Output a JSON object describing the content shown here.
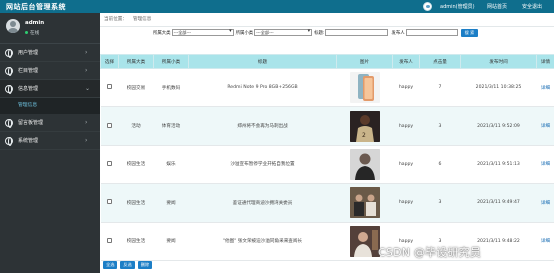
{
  "header": {
    "title": "网站后台管理系统",
    "user_label": "admin(管理员)",
    "home_link": "网站首页",
    "logout_link": "安全退出"
  },
  "sidebar": {
    "profile_name": "admin",
    "profile_status": "在线",
    "items": [
      {
        "label": "用户管理"
      },
      {
        "label": "栏目管理"
      },
      {
        "label": "信息管理"
      },
      {
        "label": "留言板管理"
      },
      {
        "label": "系统管理"
      }
    ],
    "subitem": "管理信息"
  },
  "breadcrumb": {
    "prefix": "当前位置：",
    "current": "管理信息"
  },
  "search": {
    "category_label": "所属大类",
    "category_value": "---全部---",
    "subcategory_label": "所属小类",
    "subcategory_value": "---全部---",
    "title_label": "标题:",
    "title_value": "",
    "author_label": "发布人",
    "author_value": "",
    "search_button": "搜 索"
  },
  "table": {
    "headers": [
      "选择",
      "所属大类",
      "所属小类",
      "标题",
      "图片",
      "发布人",
      "点击量",
      "发布时间",
      "详情"
    ],
    "rows": [
      {
        "category": "校园交易",
        "subcategory": "手机数码",
        "title": "Redmi Note 9 Pro 8GB+256GB",
        "author": "happy",
        "clicks": "7",
        "time": "2021/3/11 10:38:25",
        "detail": "详细"
      },
      {
        "category": "活动",
        "subcategory": "体育活动",
        "title": "郑州将不会再为马刺出战",
        "author": "happy",
        "clicks": "3",
        "time": "2021/3/11 9:52:09",
        "detail": "详细"
      },
      {
        "category": "校园生活",
        "subcategory": "娱乐",
        "title": "沙溢宣布暂停学业开拓自我位置",
        "author": "happy",
        "clicks": "6",
        "time": "2021/3/11 9:51:13",
        "detail": "详细"
      },
      {
        "category": "校园生活",
        "subcategory": "要闻",
        "title": "鉴证通代理商迪沙拥湾关委员",
        "author": "happy",
        "clicks": "3",
        "time": "2021/3/11 9:49:47",
        "detail": "详细"
      },
      {
        "category": "校园生活",
        "subcategory": "要闻",
        "title": "\"他图\" 张文荣被迫沙溢同角采来查阅长",
        "author": "happy",
        "clicks": "3",
        "time": "2021/3/11 9:48:22",
        "detail": "详细"
      }
    ]
  },
  "bottom": {
    "select_all": "全选",
    "invert": "反选",
    "delete": "删除"
  },
  "watermark": "CSDN @毕设研究员",
  "colors": {
    "topbar": "#0f6e8d",
    "sidebar": "#2d3336",
    "table_header": "#a9e4ea",
    "button": "#1c7ec6"
  }
}
